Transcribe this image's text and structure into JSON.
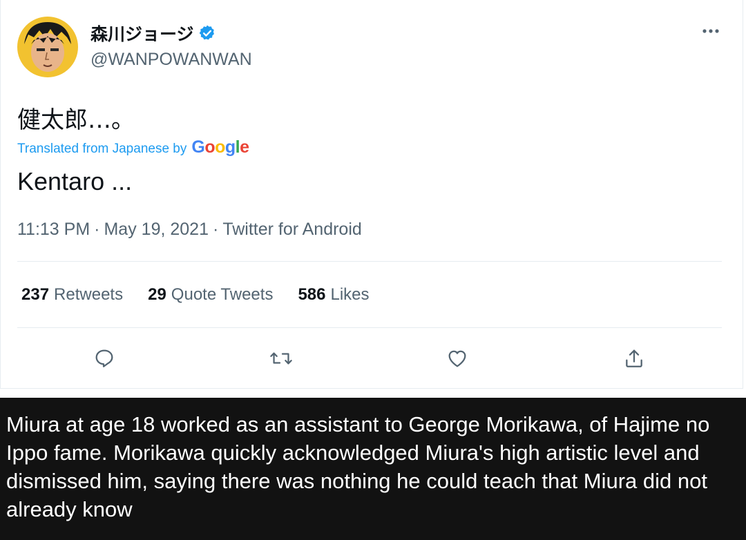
{
  "tweet": {
    "display_name": "森川ジョージ",
    "handle": "@WANPOWANWAN",
    "verified": true,
    "original_text": "健太郎…。",
    "translation_note": "Translated from Japanese by",
    "translation_provider": "Google",
    "translated_text": "Kentaro ...",
    "time": "11:13 PM",
    "separator": "·",
    "date": "May 19, 2021",
    "source": "Twitter for Android",
    "stats": [
      {
        "count": "237",
        "label": "Retweets"
      },
      {
        "count": "29",
        "label": "Quote Tweets"
      },
      {
        "count": "586",
        "label": "Likes"
      }
    ],
    "actions": [
      "reply-icon",
      "retweet-icon",
      "like-icon",
      "share-icon"
    ]
  },
  "caption": {
    "text": "Miura at age 18 worked as an assistant to George Morikawa, of Hajime no Ippo fame. Morikawa quickly acknowledged Miura's high artistic level and dismissed him, saying there was nothing he could teach that Miura did not already know"
  },
  "colors": {
    "accent": "#1d9bf0",
    "text_primary": "#0f1419",
    "text_secondary": "#536471",
    "caption_bg": "#121212"
  }
}
